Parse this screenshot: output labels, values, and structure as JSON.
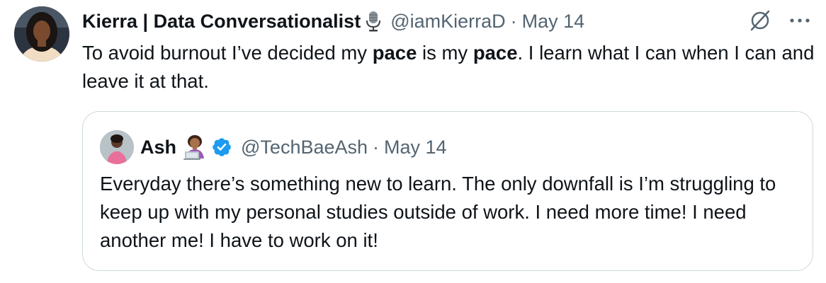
{
  "tweet": {
    "author": {
      "display_name": "Kierra | Data Conversationalist",
      "name_emoji": "microphone-emoji",
      "handle": "@iamKierraD",
      "separator": "·",
      "date": "May 14"
    },
    "text": {
      "part1": "To avoid burnout I’ve decided my ",
      "bold1": "pace",
      "part2": " is my ",
      "bold2": "pace",
      "part3": ". I learn what I can when I can and leave it at that."
    },
    "actions": {
      "grok_icon": "grok-icon",
      "more_icon": "more-icon"
    }
  },
  "quoted_tweet": {
    "author": {
      "display_name": "Ash",
      "name_emoji": "woman-technologist-emoji",
      "verified_icon": "verified-badge-icon",
      "handle": "@TechBaeAsh",
      "separator": "·",
      "date": "May 14"
    },
    "text": "Everyday there’s something new to learn. The only downfall is I’m struggling to keep up with my personal studies outside of work. I need more time! I need another me! I have to work on it!"
  },
  "colors": {
    "text_primary": "#0f1419",
    "text_secondary": "#536471",
    "border": "#cfd9de",
    "verified_blue": "#1d9bf0"
  }
}
